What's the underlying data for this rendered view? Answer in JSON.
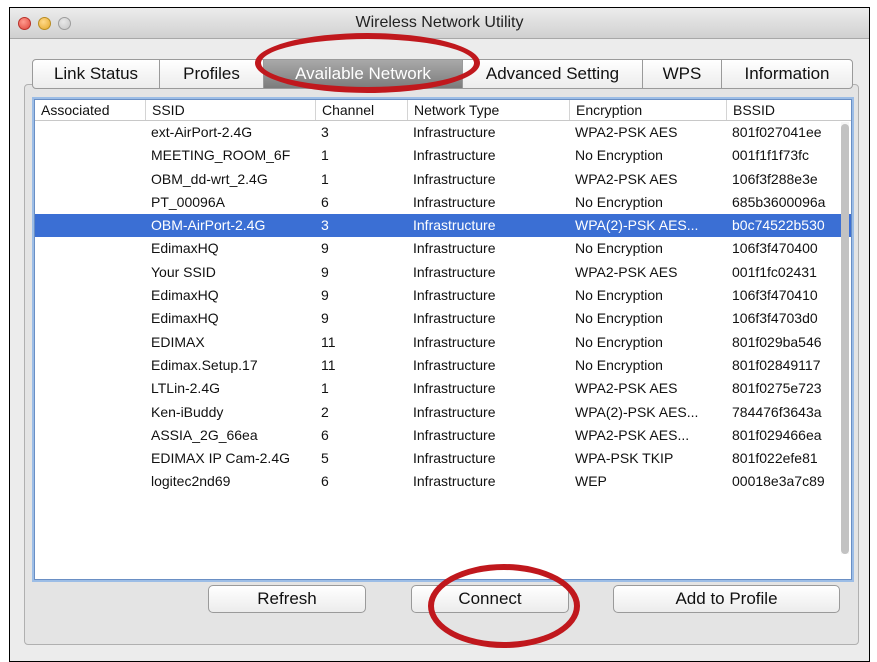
{
  "window": {
    "title": "Wireless Network Utility"
  },
  "tabs": [
    {
      "label": "Link Status"
    },
    {
      "label": "Profiles"
    },
    {
      "label": "Available Network",
      "active": true
    },
    {
      "label": "Advanced Setting"
    },
    {
      "label": "WPS"
    },
    {
      "label": "Information"
    }
  ],
  "table": {
    "columns": [
      "Associated",
      "SSID",
      "Channel",
      "Network Type",
      "Encryption",
      "BSSID"
    ],
    "selected_row": 4,
    "rows": [
      [
        "",
        "ext-AirPort-2.4G",
        "3",
        "Infrastructure",
        "WPA2-PSK AES",
        "801f027041ee"
      ],
      [
        "",
        "MEETING_ROOM_6F",
        "1",
        "Infrastructure",
        "No Encryption",
        "001f1f1f73fc"
      ],
      [
        "",
        "OBM_dd-wrt_2.4G",
        "1",
        "Infrastructure",
        "WPA2-PSK AES",
        "106f3f288e3e"
      ],
      [
        "",
        "PT_00096A",
        "6",
        "Infrastructure",
        "No Encryption",
        "685b3600096a"
      ],
      [
        "",
        "OBM-AirPort-2.4G",
        "3",
        "Infrastructure",
        "WPA(2)-PSK AES...",
        "b0c74522b530"
      ],
      [
        "",
        "EdimaxHQ",
        "9",
        "Infrastructure",
        "No Encryption",
        "106f3f470400"
      ],
      [
        "",
        "Your SSID",
        "9",
        "Infrastructure",
        "WPA2-PSK AES",
        "001f1fc02431"
      ],
      [
        "",
        "EdimaxHQ",
        "9",
        "Infrastructure",
        "No Encryption",
        "106f3f470410"
      ],
      [
        "",
        "EdimaxHQ",
        "9",
        "Infrastructure",
        "No Encryption",
        "106f3f4703d0"
      ],
      [
        "",
        "EDIMAX",
        "11",
        "Infrastructure",
        "No Encryption",
        "801f029ba546"
      ],
      [
        "",
        "Edimax.Setup.17",
        "11",
        "Infrastructure",
        "No Encryption",
        "801f02849117"
      ],
      [
        "",
        "LTLin-2.4G",
        "1",
        "Infrastructure",
        "WPA2-PSK AES",
        "801f0275e723"
      ],
      [
        "",
        "Ken-iBuddy",
        "2",
        "Infrastructure",
        "WPA(2)-PSK AES...",
        "784476f3643a"
      ],
      [
        "",
        "ASSIA_2G_66ea",
        "6",
        "Infrastructure",
        "WPA2-PSK AES...",
        "801f029466ea"
      ],
      [
        "",
        "EDIMAX IP Cam-2.4G",
        "5",
        "Infrastructure",
        "WPA-PSK TKIP",
        "801f022efe81"
      ],
      [
        "",
        "logitec2nd69",
        "6",
        "Infrastructure",
        "WEP",
        "00018e3a7c89"
      ]
    ]
  },
  "buttons": {
    "refresh": "Refresh",
    "connect": "Connect",
    "add_to_profile": "Add to Profile"
  },
  "colors": {
    "selection": "#3b6fd4",
    "highlight_ring": "#c0181d"
  }
}
